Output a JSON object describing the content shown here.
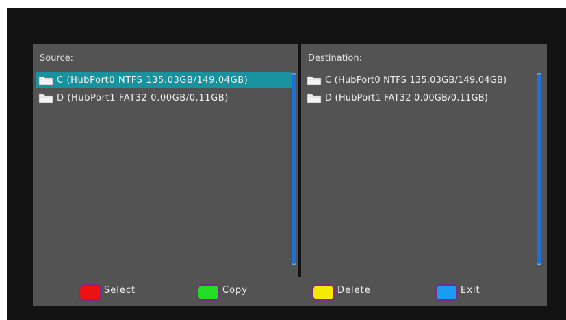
{
  "source": {
    "title": "Source:",
    "items": [
      {
        "label": "C (HubPort0 NTFS 135.03GB/149.04GB)",
        "selected": true
      },
      {
        "label": "D (HubPort1 FAT32 0.00GB/0.11GB)",
        "selected": false
      }
    ]
  },
  "destination": {
    "title": "Destination:",
    "items": [
      {
        "label": "C (HubPort0 NTFS 135.03GB/149.04GB)"
      },
      {
        "label": "D (HubPort1 FAT32 0.00GB/0.11GB)"
      }
    ]
  },
  "footer": {
    "keys": [
      {
        "label": "Select",
        "color": "#ee1111"
      },
      {
        "label": "Copy",
        "color": "#22dd22"
      },
      {
        "label": "Delete",
        "color": "#f2ea00"
      },
      {
        "label": "Exit",
        "color": "#1a9cf0"
      }
    ]
  },
  "colors": {
    "selection": "#17939f",
    "scrollbar": "#1e6fd6"
  }
}
